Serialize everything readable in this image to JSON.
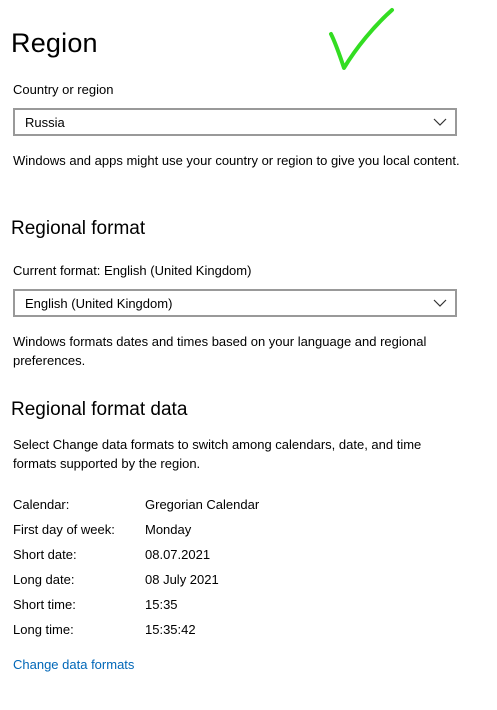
{
  "header": {
    "title": "Region"
  },
  "country": {
    "label": "Country or region",
    "selected": "Russia",
    "description": "Windows and apps might use your country or region to give you local content."
  },
  "regional_format": {
    "heading": "Regional format",
    "current_label": "Current format: English (United Kingdom)",
    "selected": "English (United Kingdom)",
    "description": "Windows formats dates and times based on your language and regional preferences."
  },
  "format_data": {
    "heading": "Regional format data",
    "description": "Select Change data formats to switch among calendars, date, and time formats supported by the region.",
    "rows": [
      {
        "key": "Calendar:",
        "value": "Gregorian Calendar"
      },
      {
        "key": "First day of week:",
        "value": "Monday"
      },
      {
        "key": "Short date:",
        "value": "08.07.2021"
      },
      {
        "key": "Long date:",
        "value": "08 July 2021"
      },
      {
        "key": "Short time:",
        "value": "15:35"
      },
      {
        "key": "Long time:",
        "value": "15:35:42"
      }
    ],
    "link_label": "Change data formats"
  },
  "icons": {
    "checkmark": "checkmark-icon",
    "dropdown": "chevron-down-icon"
  },
  "colors": {
    "link": "#0067b8",
    "checkmark": "#33dd22",
    "combo_border": "#999999"
  }
}
